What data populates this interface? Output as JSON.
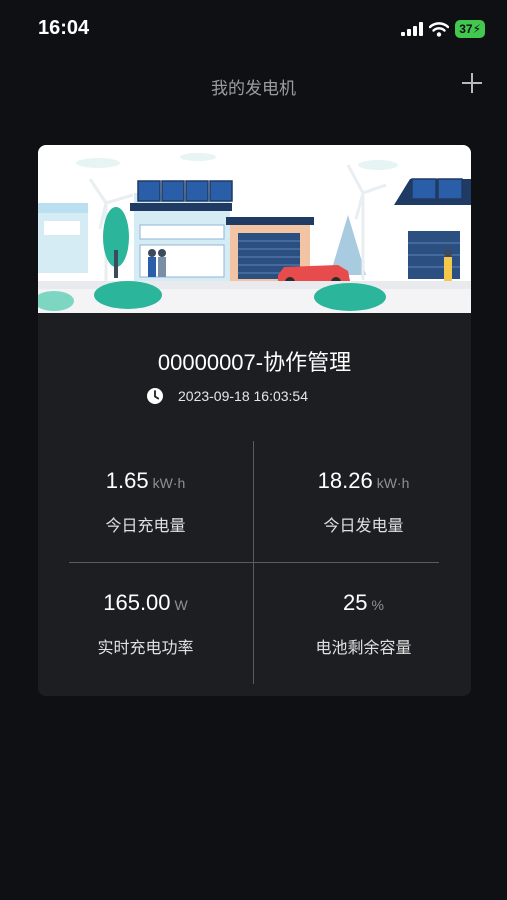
{
  "status_bar": {
    "time": "16:04",
    "battery": "37"
  },
  "nav": {
    "title": "我的发电机"
  },
  "device": {
    "name": "00000007-协作管理",
    "timestamp": "2023-09-18 16:03:54",
    "metrics": [
      {
        "value": "1.65",
        "unit": "kW·h",
        "label": "今日充电量"
      },
      {
        "value": "18.26",
        "unit": "kW·h",
        "label": "今日发电量"
      },
      {
        "value": "165.00",
        "unit": "W",
        "label": "实时充电功率"
      },
      {
        "value": "25",
        "unit": "%",
        "label": "电池剩余容量"
      }
    ]
  },
  "icons": {
    "add": "plus-icon",
    "clock": "clock-icon",
    "signal": "cellular-signal-icon",
    "wifi": "wifi-icon",
    "battery": "battery-icon"
  },
  "colors": {
    "background": "#0f1014",
    "card": "#1d1e22",
    "battery_green": "#43c84f",
    "nav_title": "#9a9ca2"
  }
}
